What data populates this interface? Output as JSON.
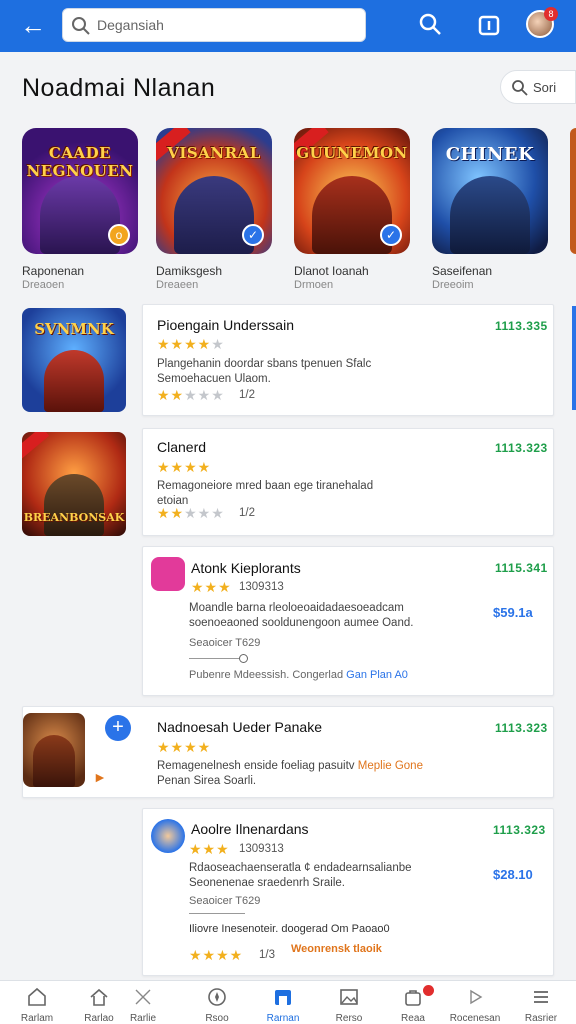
{
  "colors": {
    "app_bar": "#1e6fe0",
    "price_green": "#1e9e4a",
    "price_blue": "#2a73e8",
    "star": "#f2b01e",
    "badge_red": "#e12d2d"
  },
  "header": {
    "back_icon": "back-arrow-icon",
    "search_value": "Degansiah",
    "icons": [
      "search-icon",
      "notification-icon",
      "profile-avatar"
    ],
    "avatar_badge": "8"
  },
  "section": {
    "title": "Noadmai Nlanan",
    "sort_label": "Sori"
  },
  "carousel": [
    {
      "art_title": "CAADE NEGNOUEN",
      "name": "Raponenan",
      "sub": "Dreaoen"
    },
    {
      "art_title": "VISANRAL",
      "name": "Damiksgesh",
      "sub": "Dreaeen"
    },
    {
      "art_title": "GUUNEMON",
      "name": "Dlanot Ioanah",
      "sub": "Drmoen"
    },
    {
      "art_title": "CHINEK",
      "name": "Saseifenan",
      "sub": "Dreeoim"
    }
  ],
  "apps": [
    {
      "art_title": "SVNMNK",
      "name": "Pioengain Underssain",
      "price": "1113.335",
      "rating": 4,
      "desc_lines": [
        "Plangehanin doordar sbans tpenuen Sfalc",
        "Semoehacuen Ulaom."
      ],
      "sub_rating": 2,
      "sub_count": "1/2"
    },
    {
      "art_title": "BREANBONSAK",
      "name": "Clanerd",
      "price": "1113.323",
      "rating": 4,
      "desc_lines": [
        "Remagoneiore mred baan ege tiranehalad",
        "etoian"
      ],
      "sub_rating": 2,
      "sub_count": "1/2"
    },
    {
      "name": "Atonk Kieplorants",
      "price": "1115.341",
      "rating": 3,
      "count": "1309313",
      "desc_lines": [
        "Moandle barna rleoloeoaidadaesoeadcam",
        "soenoeaoned sooldunengoon aumee Oand."
      ],
      "side_price": "$59.1a",
      "meta_code": "Seaoicer T629",
      "footer_prefix": "Pubenre Mdeessish. Congerlad",
      "footer_link": "Gan Plan A0"
    },
    {
      "name": "Nadnoesah Ueder Panake",
      "price": "1113.323",
      "rating": 4,
      "desc_lines": [
        "Remagenelnesh enside foeliag pasuitv",
        "Penan Sirea Soarli."
      ],
      "desc_highlight": "Meplie Gone",
      "add_label": "+"
    },
    {
      "name": "Aoolre Ilnenardans",
      "price": "1113.323",
      "rating": 3,
      "count": "1309313",
      "desc_lines": [
        "Rdaoseachaenseratla ¢ endadearnsalianbe",
        "Seonenenae sraedenrh Sraile."
      ],
      "side_price": "$28.10",
      "meta_code": "Seaoicer T629",
      "footer_prefix": "Iliovre Inesenoteir. doogerad Om Paoao0",
      "footer_rating": 4,
      "footer_count": "1/3",
      "footer_link": "Weonrensk tlaoik"
    }
  ],
  "bottom_nav": [
    {
      "label": "Rarlam",
      "icon": "home-icon"
    },
    {
      "label": "Rarlao",
      "icon": "home-outline-icon"
    },
    {
      "label": "Rarlie",
      "icon": "swords-icon"
    },
    {
      "label": "Rsoo",
      "icon": "compass-icon"
    },
    {
      "label": "Rarnan",
      "icon": "store-icon"
    },
    {
      "label": "Rerso",
      "icon": "image-icon"
    },
    {
      "label": "Reaa",
      "icon": "bag-icon"
    },
    {
      "label": "Rocenesan",
      "icon": "play-icon"
    },
    {
      "label": "Rasrier",
      "icon": "menu-icon"
    }
  ],
  "active_nav": 4
}
